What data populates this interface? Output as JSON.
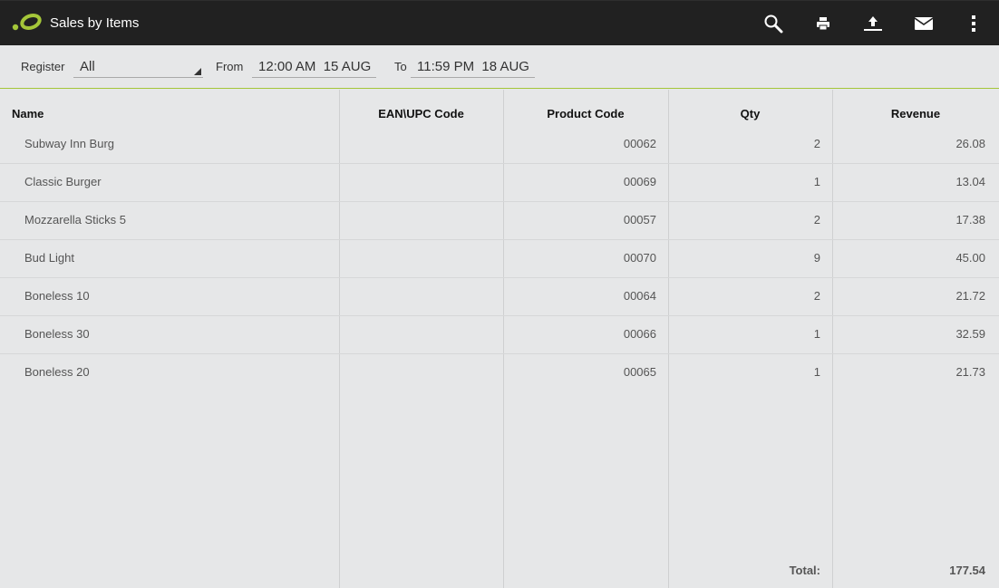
{
  "app": {
    "title": "Sales by Items",
    "logo_icon": "app-logo",
    "accent_color": "#a4c639"
  },
  "actions": [
    {
      "name": "search-icon",
      "label": "Search"
    },
    {
      "name": "print-icon",
      "label": "Print"
    },
    {
      "name": "export-upload-icon",
      "label": "Export"
    },
    {
      "name": "email-icon",
      "label": "Email"
    },
    {
      "name": "overflow-menu-icon",
      "label": "More options"
    }
  ],
  "filters": {
    "register_label": "Register",
    "register_value": "All",
    "from_label": "From",
    "from_value": "12:00 AM  15 AUG",
    "to_label": "To",
    "to_value": "11:59 PM  18 AUG"
  },
  "table": {
    "headers": {
      "name": "Name",
      "ean": "EAN\\UPC Code",
      "product_code": "Product Code",
      "qty": "Qty",
      "revenue": "Revenue"
    },
    "rows": [
      {
        "name": "Subway Inn Burg",
        "ean": "",
        "product_code": "00062",
        "qty": "2",
        "revenue": "26.08"
      },
      {
        "name": "Classic Burger",
        "ean": "",
        "product_code": "00069",
        "qty": "1",
        "revenue": "13.04"
      },
      {
        "name": "Mozzarella Sticks 5",
        "ean": "",
        "product_code": "00057",
        "qty": "2",
        "revenue": "17.38"
      },
      {
        "name": "Bud Light",
        "ean": "",
        "product_code": "00070",
        "qty": "9",
        "revenue": "45.00"
      },
      {
        "name": "Boneless 10",
        "ean": "",
        "product_code": "00064",
        "qty": "2",
        "revenue": "21.72"
      },
      {
        "name": "Boneless 30",
        "ean": "",
        "product_code": "00066",
        "qty": "1",
        "revenue": "32.59"
      },
      {
        "name": "Boneless 20",
        "ean": "",
        "product_code": "00065",
        "qty": "1",
        "revenue": "21.73"
      }
    ],
    "total_label": "Total:",
    "total_value": "177.54"
  }
}
